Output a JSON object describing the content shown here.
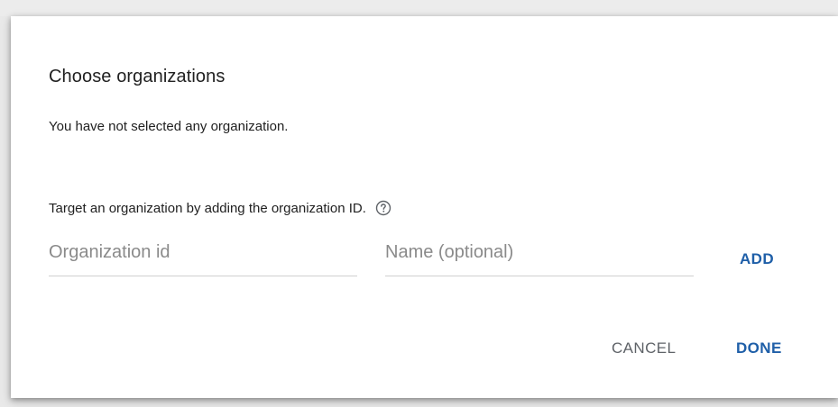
{
  "dialog": {
    "title": "Choose organizations",
    "status_text": "You have not selected any organization.",
    "target_prompt": "Target an organization by adding the organization ID.",
    "help_icon": "help-circle-icon",
    "org_id_input": {
      "placeholder": "Organization id",
      "value": ""
    },
    "name_input": {
      "placeholder": "Name (optional)",
      "value": ""
    },
    "add_label": "ADD",
    "cancel_label": "CANCEL",
    "done_label": "DONE"
  },
  "colors": {
    "accent": "#1f5fa8",
    "text": "#212121",
    "muted": "#5f6368"
  }
}
